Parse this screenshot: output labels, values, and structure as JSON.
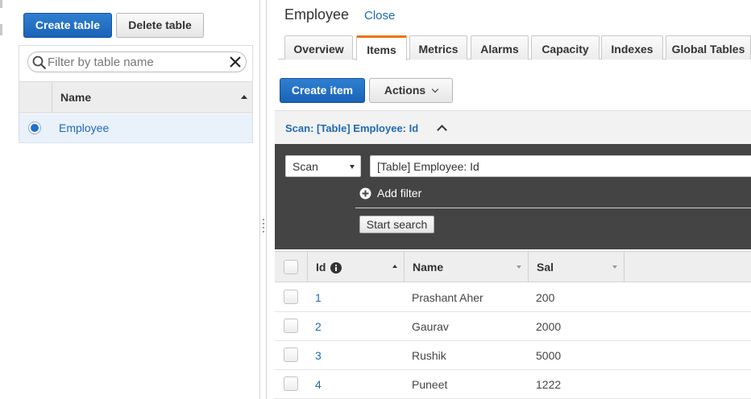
{
  "left_panel": {
    "create_table_label": "Create table",
    "delete_table_label": "Delete table",
    "filter_placeholder": "Filter by table name",
    "column_header": "Name",
    "tables": [
      {
        "name": "Employee",
        "selected": true
      }
    ]
  },
  "right_panel": {
    "table_title": "Employee",
    "close_label": "Close",
    "tabs": [
      {
        "label": "Overview",
        "active": false
      },
      {
        "label": "Items",
        "active": true
      },
      {
        "label": "Metrics",
        "active": false
      },
      {
        "label": "Alarms",
        "active": false
      },
      {
        "label": "Capacity",
        "active": false
      },
      {
        "label": "Indexes",
        "active": false
      },
      {
        "label": "Global Tables",
        "active": false
      }
    ],
    "create_item_label": "Create item",
    "actions_label": "Actions",
    "scan_header": "Scan: [Table] Employee: Id",
    "scan_mode": "Scan",
    "scan_target": "[Table] Employee: Id",
    "add_filter_label": "Add filter",
    "start_search_label": "Start search",
    "columns": [
      "Id",
      "Name",
      "Sal"
    ],
    "items": [
      {
        "id": "1",
        "name": "Prashant Aher",
        "sal": "200"
      },
      {
        "id": "2",
        "name": "Gaurav",
        "sal": "2000"
      },
      {
        "id": "3",
        "name": "Rushik",
        "sal": "5000"
      },
      {
        "id": "4",
        "name": "Puneet",
        "sal": "1222"
      }
    ]
  },
  "colors": {
    "primary_button": "#1f6fc9",
    "link": "#1f6ab5",
    "active_tab_accent": "#ec7211",
    "filter_panel_bg": "#444444"
  }
}
